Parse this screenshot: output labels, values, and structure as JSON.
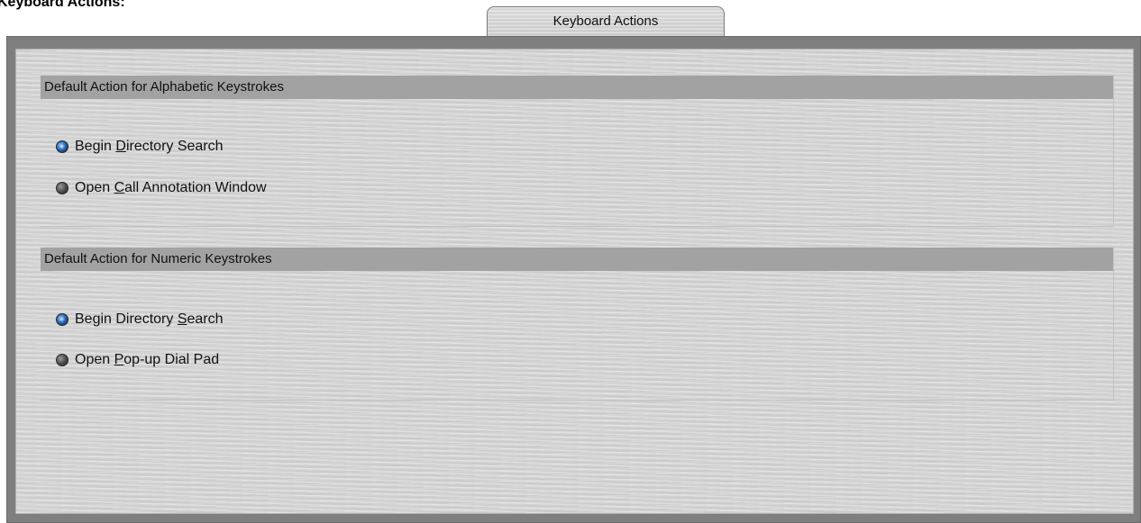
{
  "caption": "Keyboard Actions:",
  "tab": {
    "label": "Keyboard Actions"
  },
  "alphabetic": {
    "header": "Default Action for Alphabetic Keystrokes",
    "options": [
      {
        "pre": "Begin ",
        "mnemonic": "D",
        "post": "irectory Search",
        "checked": true
      },
      {
        "pre": "Open ",
        "mnemonic": "C",
        "post": "all Annotation Window",
        "checked": false
      }
    ]
  },
  "numeric": {
    "header": "Default Action for Numeric Keystrokes",
    "options": [
      {
        "pre": "Begin Directory ",
        "mnemonic": "S",
        "post": "earch",
        "checked": true
      },
      {
        "pre": "Open ",
        "mnemonic": "P",
        "post": "op-up Dial Pad",
        "checked": false
      }
    ]
  }
}
